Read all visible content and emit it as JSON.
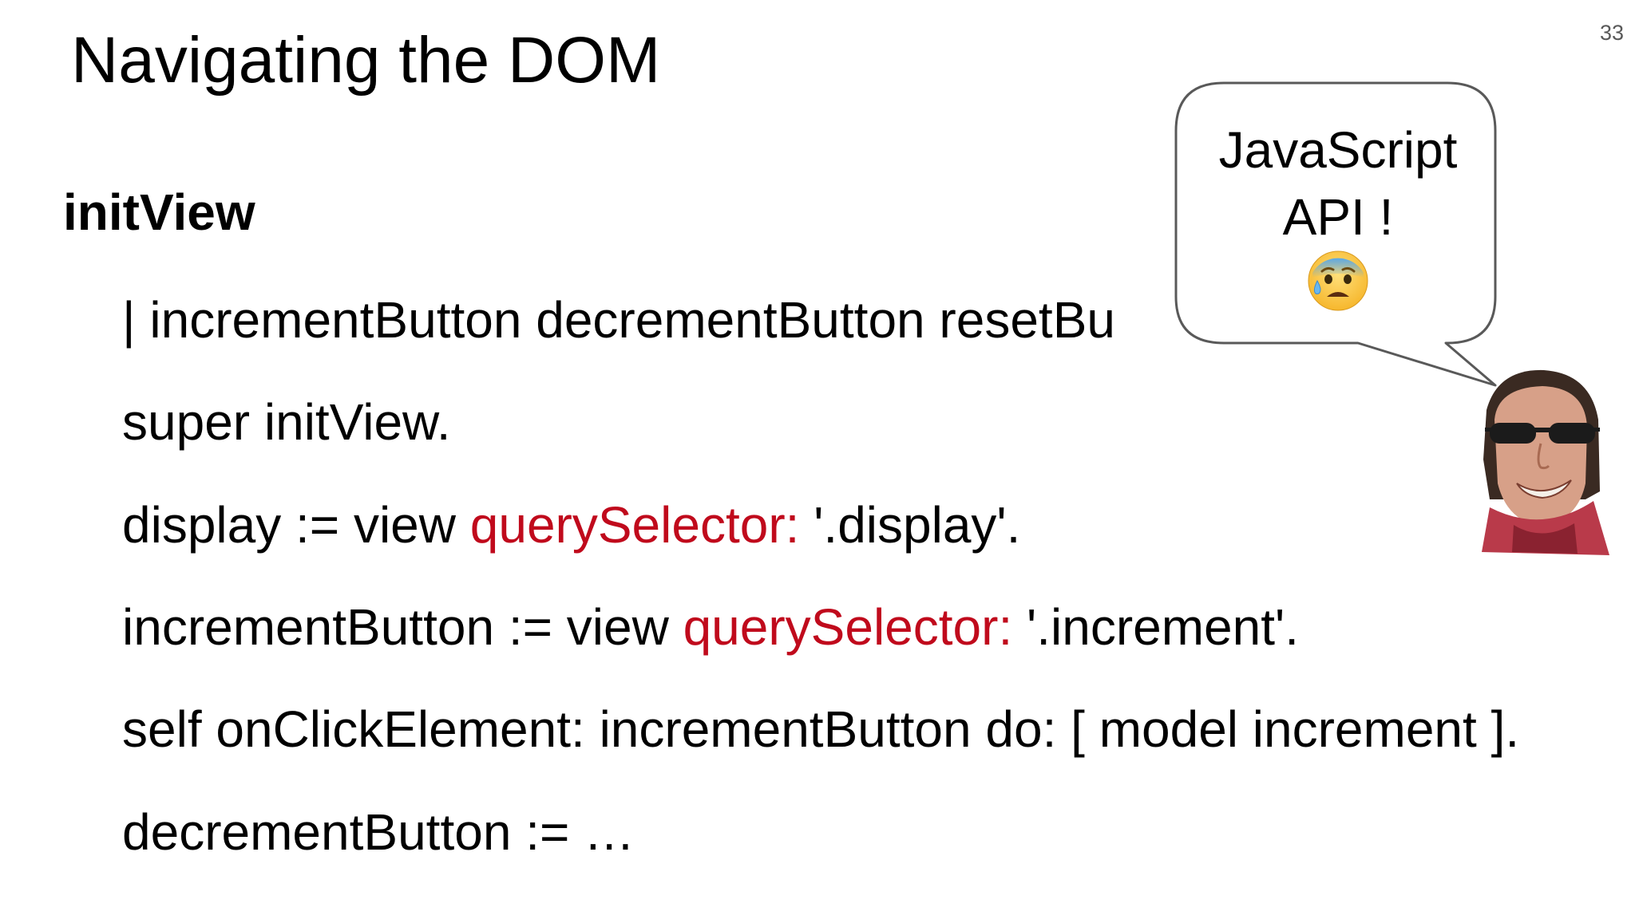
{
  "slide": {
    "number": "33",
    "title": "Navigating the DOM"
  },
  "code": {
    "method_name": "initView",
    "lines": [
      {
        "segments": [
          {
            "text": "| incrementButton decrementButton resetBu",
            "kw": false
          }
        ]
      },
      {
        "segments": [
          {
            "text": "super initView.",
            "kw": false
          }
        ]
      },
      {
        "segments": [
          {
            "text": "display := view ",
            "kw": false
          },
          {
            "text": "querySelector:",
            "kw": true
          },
          {
            "text": " '.display'.",
            "kw": false
          }
        ]
      },
      {
        "segments": [
          {
            "text": "incrementButton := view ",
            "kw": false
          },
          {
            "text": "querySelector:",
            "kw": true
          },
          {
            "text": " '.increment'.",
            "kw": false
          }
        ]
      },
      {
        "segments": [
          {
            "text": "self onClickElement: incrementButton do: [ model increment ].",
            "kw": false
          }
        ]
      },
      {
        "segments": [
          {
            "text": "decrementButton := …",
            "kw": false
          }
        ]
      }
    ],
    "keyword_color": "#c00a1c"
  },
  "callout": {
    "line1": "JavaScript",
    "line2": "API !",
    "emoji_icon": "anxious-face-with-sweat-icon"
  },
  "avatar": {
    "icon": "presenter-photo"
  }
}
